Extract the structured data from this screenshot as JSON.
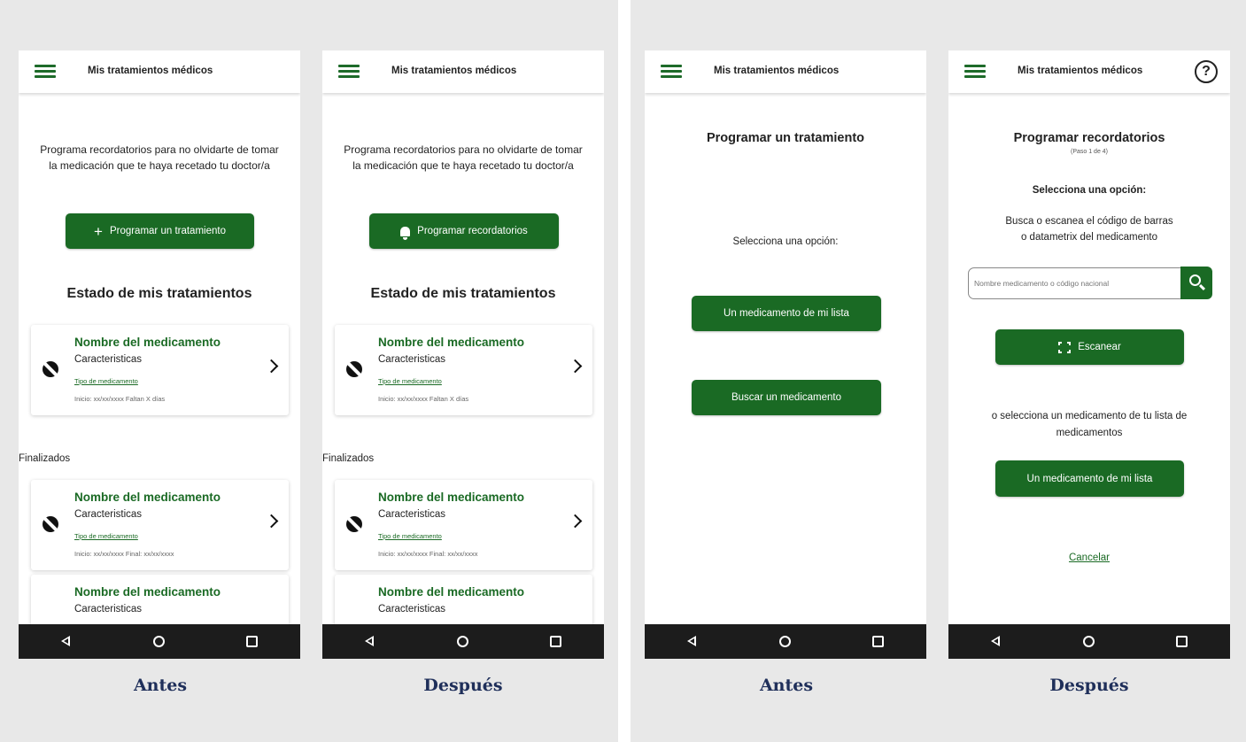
{
  "app_title": "Mis tratamientos médicos",
  "screen1": {
    "intro": "Programa recordatorios para no olvidarte de tomar la medicación que te haya recetado tu doctor/a",
    "cta": "Programar un tratamiento",
    "status_heading": "Estado de mis tratamientos",
    "active_card": {
      "name": "Nombre del medicamento",
      "chars": "Caracteristicas",
      "type": "Tipo de medicamento",
      "dates": "Inicio: xx/xx/xxxx  Faltan X días"
    },
    "finished_label": "Finalizados",
    "finished_card": {
      "name": "Nombre del medicamento",
      "chars": "Caracteristicas",
      "type": "Tipo de medicamento",
      "dates": "Inicio: xx/xx/xxxx  Final: xx/xx/xxxx"
    },
    "partial_card": {
      "name": "Nombre del medicamento",
      "chars": "Caracteristicas"
    }
  },
  "screen2": {
    "intro": "Programa recordatorios para no olvidarte de tomar la medicación que te haya recetado tu doctor/a",
    "cta": "Programar recordatorios",
    "status_heading": "Estado de mis tratamientos",
    "active_card": {
      "name": "Nombre del medicamento",
      "chars": "Caracteristicas",
      "type": "Tipo de medicamento",
      "dates": "Inicio: xx/xx/xxxx  Faltan X días"
    },
    "finished_label": "Finalizados",
    "finished_card": {
      "name": "Nombre del medicamento",
      "chars": "Caracteristicas",
      "type": "Tipo de medicamento",
      "dates": "Inicio: xx/xx/xxxx  Final: xx/xx/xxxx"
    },
    "partial_card": {
      "name": "Nombre del medicamento",
      "chars": "Caracteristicas"
    }
  },
  "screen3": {
    "heading": "Programar un tratamiento",
    "prompt": "Selecciona una opción:",
    "option_list": "Un medicamento de mi lista",
    "option_search": "Buscar un medicamento"
  },
  "screen4": {
    "heading": "Programar recordatorios",
    "step": "(Paso 1 de 4)",
    "prompt": "Selecciona una opción:",
    "instructions": "Busca o escanea el código de barras o datametrix del medicamento",
    "search_placeholder": "Nombre medicamento o código nacional",
    "scan_label": "Escanear",
    "or_select": "o selecciona un medicamento de tu lista de medicamentos",
    "option_list": "Un medicamento de mi lista",
    "cancel": "Cancelar"
  },
  "captions": {
    "before": "Antes",
    "after": "Después"
  },
  "colors": {
    "accent": "#1a6a24",
    "caption": "#1f2f5a",
    "panel_bg": "#e8e8e8",
    "navbar": "#1c1c1c"
  },
  "icons": [
    "hamburger-icon",
    "plus-icon",
    "bell-icon",
    "pill-icon",
    "capsule-icon",
    "chevron-right-icon",
    "help-icon",
    "search-icon",
    "scan-icon",
    "back-icon",
    "home-icon",
    "recent-apps-icon"
  ]
}
